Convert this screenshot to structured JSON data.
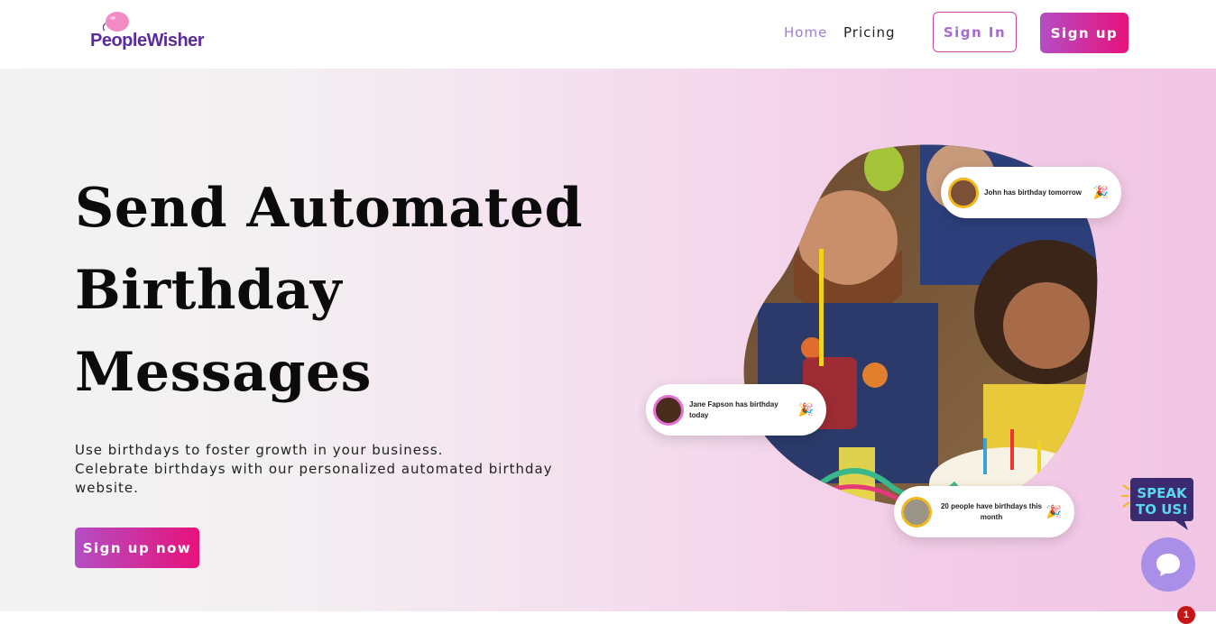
{
  "header": {
    "logo_text": "PeopleWisher",
    "nav": {
      "home": "Home",
      "pricing": "Pricing"
    },
    "sign_in": "Sign In",
    "sign_up": "Sign up"
  },
  "hero": {
    "headline": [
      "Send Automated",
      "Birthday",
      "Messages"
    ],
    "subtext": [
      "Use birthdays to foster growth in your business.",
      "Celebrate birthdays with our personalized automated birthday",
      "website."
    ],
    "cta": "Sign up now"
  },
  "notifications": [
    {
      "text": "John has birthday tomorrow"
    },
    {
      "text": "Jane Fapson has birthday today"
    },
    {
      "text": "20 people have birthdays this month"
    }
  ],
  "widgets": {
    "speak_line1": "SPEAK",
    "speak_line2": "TO US!",
    "chat_badge": "1"
  },
  "colors": {
    "brand_purple": "#5b2ca0",
    "gradient_start": "#b34ec4",
    "gradient_end": "#e8127a",
    "nav_active": "#9b7fd8",
    "hero_bg_pink": "#f1c6e4"
  }
}
